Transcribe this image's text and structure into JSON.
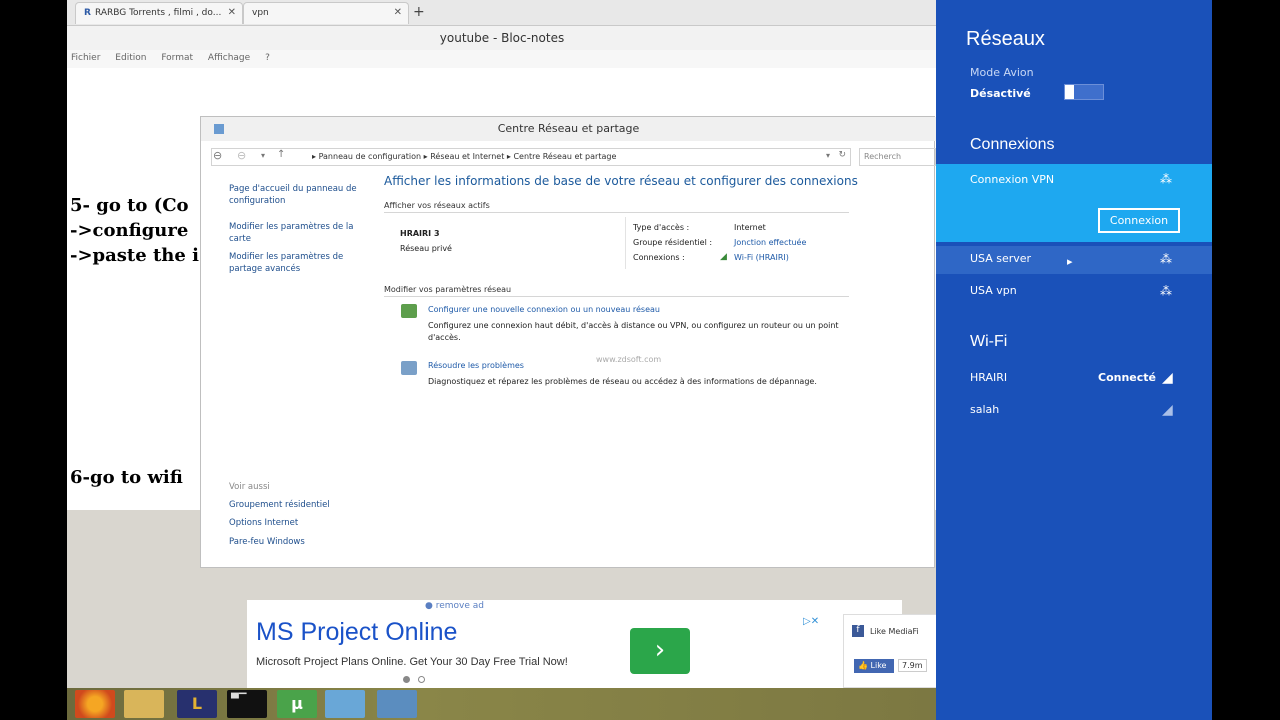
{
  "browser": {
    "tabs": [
      {
        "label": "RARBG Torrents , filmi , do..."
      },
      {
        "label": "vpn"
      }
    ],
    "new_tab": "+"
  },
  "notepad": {
    "title": "youtube - Bloc-notes",
    "menu": [
      "Fichier",
      "Edition",
      "Format",
      "Affichage",
      "?"
    ],
    "lines": [
      "5- go to (Co",
      "->configure",
      "->paste the i",
      "6-go to wifi"
    ]
  },
  "control_panel": {
    "title": "Centre Réseau et partage",
    "address": [
      "Panneau de configuration",
      "Réseau et Internet",
      "Centre Réseau et partage"
    ],
    "search_placeholder": "Recherch",
    "sidebar": [
      "Page d'accueil du panneau de configuration",
      "Modifier les paramètres de la carte",
      "Modifier les paramètres de partage avancés"
    ],
    "see_also_label": "Voir aussi",
    "see_also": [
      "Groupement résidentiel",
      "Options Internet",
      "Pare-feu Windows"
    ],
    "heading": "Afficher les informations de base de votre réseau et configurer des connexions",
    "active_networks_label": "Afficher vos réseaux actifs",
    "network_name": "HRAIRI 3",
    "network_type": "Réseau privé",
    "access_type_label": "Type d'accès :",
    "access_type_value": "Internet",
    "homegroup_label": "Groupe résidentiel :",
    "homegroup_value": "Jonction effectuée",
    "connections_label": "Connexions :",
    "connections_value": "Wi-Fi (HRAIRI)",
    "modify_label": "Modifier vos paramètres réseau",
    "task1_title": "Configurer une nouvelle connexion ou un nouveau réseau",
    "task1_desc": "Configurez une connexion haut débit, d'accès à distance ou VPN, ou configurez un routeur ou un point d'accès.",
    "task2_title": "Résoudre les problèmes",
    "task2_desc": "Diagnostiquez et réparez les problèmes de réseau ou accédez à des informations de dépannage.",
    "watermark": "www.zdsoft.com"
  },
  "ad": {
    "remove": "remove ad",
    "title": "MS Project Online",
    "desc": "Microsoft Project Plans Online. Get Your 30 Day Free Trial Now!",
    "go": "›",
    "fb_title": "Like MediaFi",
    "fb_like": "Like",
    "fb_count": "7.9m"
  },
  "network_panel": {
    "title": "Réseaux",
    "airplane_label": "Mode Avion",
    "airplane_state": "Désactivé",
    "connections_heading": "Connexions",
    "vpn_items": [
      "Connexion VPN",
      "USA server",
      "USA vpn"
    ],
    "connect_button": "Connexion",
    "wifi_heading": "Wi-Fi",
    "wifi_items": [
      {
        "name": "HRAIRI",
        "status": "Connecté"
      },
      {
        "name": "salah",
        "status": ""
      }
    ]
  }
}
